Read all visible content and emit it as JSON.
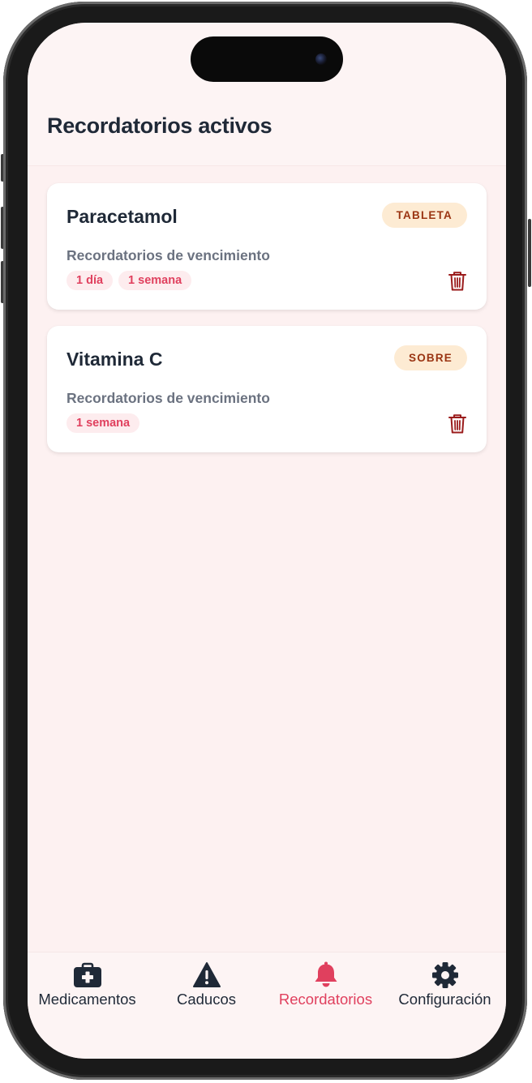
{
  "page": {
    "title": "Recordatorios activos"
  },
  "reminders": [
    {
      "name": "Paracetamol",
      "type": "TABLETA",
      "label": "Recordatorios de vencimiento",
      "chips": [
        "1 día",
        "1 semana"
      ],
      "delete_icon": "trash-icon"
    },
    {
      "name": "Vitamina C",
      "type": "SOBRE",
      "label": "Recordatorios de vencimiento",
      "chips": [
        "1 semana"
      ],
      "delete_icon": "trash-icon"
    }
  ],
  "tabbar": {
    "active": "Recordatorios",
    "items": [
      {
        "label": "Medicamentos",
        "icon": "medical-kit-icon"
      },
      {
        "label": "Caducos",
        "icon": "warning-icon"
      },
      {
        "label": "Recordatorios",
        "icon": "bell-icon"
      },
      {
        "label": "Configuración",
        "icon": "gear-icon"
      }
    ]
  },
  "colors": {
    "accent": "#e0405e",
    "background": "#fdf1f1",
    "text": "#1f2937",
    "muted": "#6b7280",
    "badge_bg": "#fdebd3",
    "badge_text": "#9a3412",
    "chip_bg": "#fdecee",
    "trash": "#9b1c1c"
  }
}
